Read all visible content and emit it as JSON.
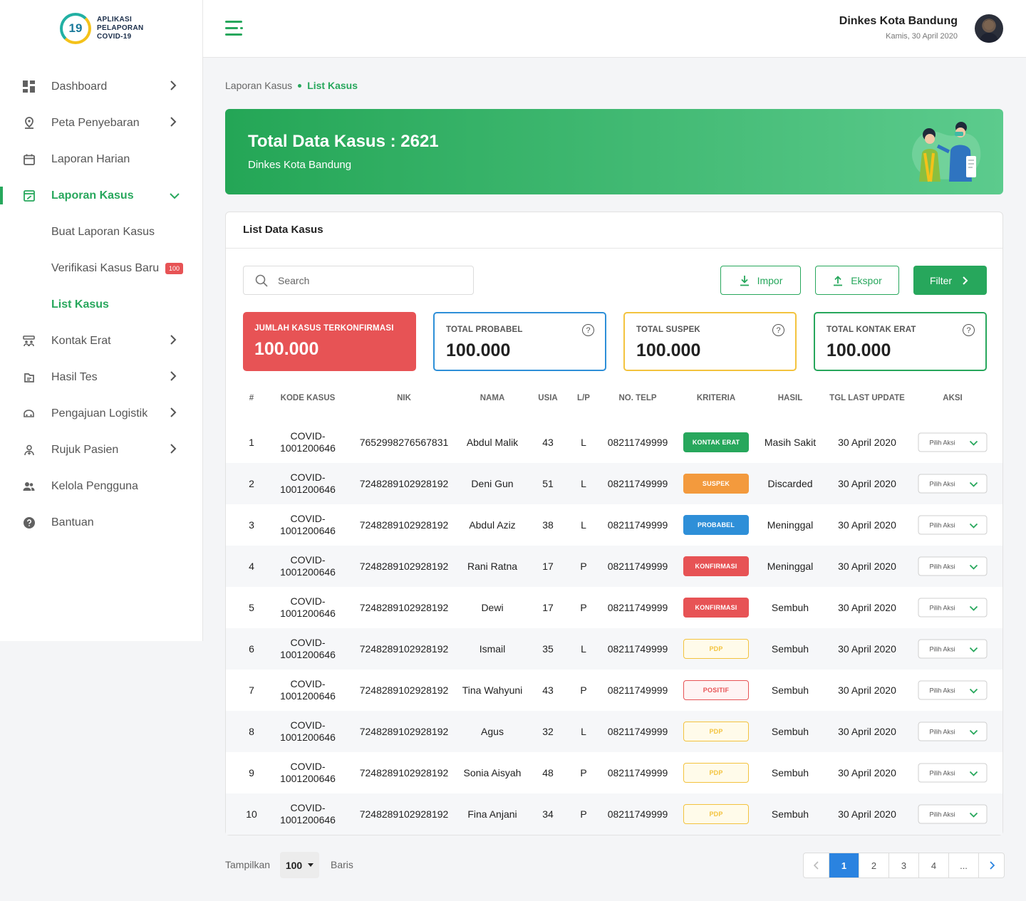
{
  "app": {
    "logo_badge": "19",
    "logo_text": "APLIKASI PELAPORAN COVID-19"
  },
  "sidebar": {
    "items": [
      {
        "label": "Dashboard",
        "icon": "grid-icon"
      },
      {
        "label": "Peta Penyebaran",
        "icon": "map-pin-icon"
      },
      {
        "label": "Laporan Harian",
        "icon": "calendar-icon"
      },
      {
        "label": "Laporan Kasus",
        "icon": "edit-document-icon"
      },
      {
        "label": "Buat Laporan Kasus"
      },
      {
        "label": "Verifikasi Kasus Baru",
        "badge": "100"
      },
      {
        "label": "List Kasus"
      },
      {
        "label": "Kontak Erat",
        "icon": "contacts-icon"
      },
      {
        "label": "Hasil Tes",
        "icon": "test-result-icon"
      },
      {
        "label": "Pengajuan Logistik",
        "icon": "logistics-icon"
      },
      {
        "label": "Rujuk Pasien",
        "icon": "patient-referral-icon"
      },
      {
        "label": "Kelola Pengguna",
        "icon": "users-icon"
      },
      {
        "label": "Bantuan",
        "icon": "help-icon"
      }
    ]
  },
  "header": {
    "user_name": "Dinkes Kota Bandung",
    "date": "Kamis, 30 April 2020"
  },
  "breadcrumb": {
    "parent": "Laporan Kasus",
    "current": "List Kasus"
  },
  "banner": {
    "title": "Total Data Kasus : 2621",
    "subtitle": "Dinkes Kota Bandung"
  },
  "card": {
    "title": "List Data Kasus",
    "search_placeholder": "Search",
    "import_label": "Impor",
    "export_label": "Ekspor",
    "filter_label": "Filter"
  },
  "stats": [
    {
      "label": "JUMLAH KASUS TERKONFIRMASI",
      "value": "100.000",
      "color": "#e75355"
    },
    {
      "label": "TOTAL PROBABEL",
      "value": "100.000",
      "color": "#2e8fd8",
      "help": "?"
    },
    {
      "label": "TOTAL SUSPEK",
      "value": "100.000",
      "color": "#f3c33e",
      "help": "?"
    },
    {
      "label": "TOTAL KONTAK ERAT",
      "value": "100.000",
      "color": "#27a75c",
      "help": "?"
    }
  ],
  "table": {
    "columns": [
      "#",
      "KODE KASUS",
      "NIK",
      "NAMA",
      "USIA",
      "L/P",
      "NO. TELP",
      "KRITERIA",
      "HASIL",
      "TGL LAST UPDATE",
      "AKSI"
    ],
    "rows": [
      {
        "no": "1",
        "kode1": "COVID-",
        "kode2": "1001200646",
        "nik": "7652998276567831",
        "nama": "Abdul Malik",
        "usia": "43",
        "lp": "L",
        "telp": "08211749999",
        "kriteria": "KONTAK ERAT",
        "hasil": "Masih Sakit",
        "tgl": "30 April 2020",
        "aksi": "Pilih Aksi"
      },
      {
        "no": "2",
        "kode1": "COVID-",
        "kode2": "1001200646",
        "nik": "7248289102928192",
        "nama": "Deni Gun",
        "usia": "51",
        "lp": "L",
        "telp": "08211749999",
        "kriteria": "SUSPEK",
        "hasil": "Discarded",
        "tgl": "30 April 2020",
        "aksi": "Pilih Aksi"
      },
      {
        "no": "3",
        "kode1": "COVID-",
        "kode2": "1001200646",
        "nik": "7248289102928192",
        "nama": "Abdul Aziz",
        "usia": "38",
        "lp": "L",
        "telp": "08211749999",
        "kriteria": "PROBABEL",
        "hasil": "Meninggal",
        "tgl": "30 April 2020",
        "aksi": "Pilih Aksi"
      },
      {
        "no": "4",
        "kode1": "COVID-",
        "kode2": "1001200646",
        "nik": "7248289102928192",
        "nama": "Rani Ratna",
        "usia": "17",
        "lp": "P",
        "telp": "08211749999",
        "kriteria": "KONFIRMASI",
        "hasil": "Meninggal",
        "tgl": "30 April 2020",
        "aksi": "Pilih Aksi"
      },
      {
        "no": "5",
        "kode1": "COVID-",
        "kode2": "1001200646",
        "nik": "7248289102928192",
        "nama": "Dewi",
        "usia": "17",
        "lp": "P",
        "telp": "08211749999",
        "kriteria": "KONFIRMASI",
        "hasil": "Sembuh",
        "tgl": "30 April 2020",
        "aksi": "Pilih Aksi"
      },
      {
        "no": "6",
        "kode1": "COVID-",
        "kode2": "1001200646",
        "nik": "7248289102928192",
        "nama": "Ismail",
        "usia": "35",
        "lp": "L",
        "telp": "08211749999",
        "kriteria": "PDP",
        "hasil": "Sembuh",
        "tgl": "30 April 2020",
        "aksi": "Pilih Aksi"
      },
      {
        "no": "7",
        "kode1": "COVID-",
        "kode2": "1001200646",
        "nik": "7248289102928192",
        "nama": "Tina Wahyuni",
        "usia": "43",
        "lp": "P",
        "telp": "08211749999",
        "kriteria": "POSITIF",
        "hasil": "Sembuh",
        "tgl": "30 April 2020",
        "aksi": "Pilih Aksi"
      },
      {
        "no": "8",
        "kode1": "COVID-",
        "kode2": "1001200646",
        "nik": "7248289102928192",
        "nama": "Agus",
        "usia": "32",
        "lp": "L",
        "telp": "08211749999",
        "kriteria": "PDP",
        "hasil": "Sembuh",
        "tgl": "30 April 2020",
        "aksi": "Pilih Aksi"
      },
      {
        "no": "9",
        "kode1": "COVID-",
        "kode2": "1001200646",
        "nik": "7248289102928192",
        "nama": "Sonia Aisyah",
        "usia": "48",
        "lp": "P",
        "telp": "08211749999",
        "kriteria": "PDP",
        "hasil": "Sembuh",
        "tgl": "30 April 2020",
        "aksi": "Pilih Aksi"
      },
      {
        "no": "10",
        "kode1": "COVID-",
        "kode2": "1001200646",
        "nik": "7248289102928192",
        "nama": "Fina Anjani",
        "usia": "34",
        "lp": "P",
        "telp": "08211749999",
        "kriteria": "PDP",
        "hasil": "Sembuh",
        "tgl": "30 April 2020",
        "aksi": "Pilih Aksi"
      }
    ]
  },
  "kriteria_styles": {
    "KONTAK ERAT": {
      "bg": "#27a75c",
      "fg": "#ffffff",
      "border": "#27a75c"
    },
    "SUSPEK": {
      "bg": "#f39a3d",
      "fg": "#ffffff",
      "border": "#f39a3d"
    },
    "PROBABEL": {
      "bg": "#2e8fd8",
      "fg": "#ffffff",
      "border": "#2e8fd8"
    },
    "KONFIRMASI": {
      "bg": "#e75355",
      "fg": "#ffffff",
      "border": "#e75355"
    },
    "PDP": {
      "bg": "#fffbea",
      "fg": "#f3c33e",
      "border": "#f3c33e"
    },
    "POSITIF": {
      "bg": "#fff4f4",
      "fg": "#e75355",
      "border": "#e75355"
    }
  },
  "footer": {
    "show_label": "Tampilkan",
    "show_value": "100",
    "rows_label": "Baris",
    "pages": [
      "1",
      "2",
      "3",
      "4",
      "..."
    ],
    "active_page": "1"
  }
}
